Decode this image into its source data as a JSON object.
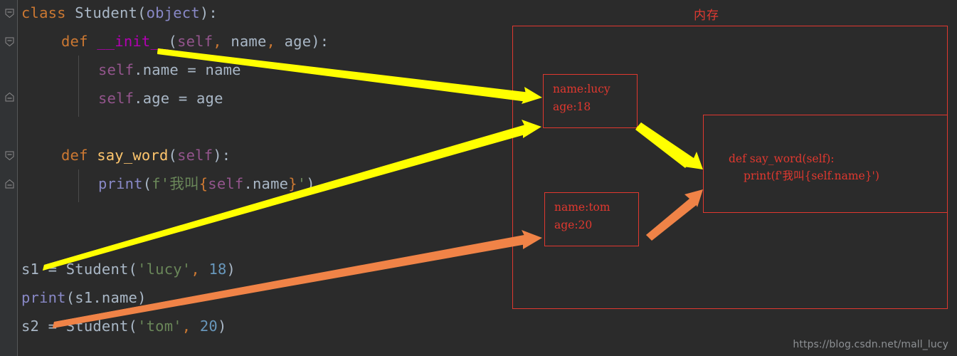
{
  "editor": {
    "background_color": "#2b2b2b",
    "gutter_color": "#313335",
    "fold_markers": [
      "fold-minus-marker",
      "fold-minus-marker",
      "fold-minus-marker",
      "fold-minus-marker",
      "fold-minus-marker"
    ],
    "code_lines": [
      {
        "id": "line-class",
        "text": "class Student(object):"
      },
      {
        "id": "line-init-def",
        "text": "    def __init__(self, name, age):"
      },
      {
        "id": "line-self-name",
        "text": "        self.name = name"
      },
      {
        "id": "line-self-age",
        "text": "        self.age = age"
      },
      {
        "id": "line-blank-1",
        "text": ""
      },
      {
        "id": "line-saywordd",
        "text": "    def say_word(self):"
      },
      {
        "id": "line-print-f",
        "text": "        print(f'我叫{self.name}')"
      },
      {
        "id": "line-blank-2",
        "text": ""
      },
      {
        "id": "line-blank-3",
        "text": ""
      },
      {
        "id": "line-s1",
        "text": "s1 = Student('lucy', 18)"
      },
      {
        "id": "line-print-s1",
        "text": "print(s1.name)"
      },
      {
        "id": "line-s2",
        "text": "s2 = Student('tom', 20)"
      }
    ],
    "tokens": {
      "kw_class": "class",
      "name_student": "Student",
      "builtin_object": "object",
      "kw_def": "def",
      "magic_init": "__init__",
      "self": "self",
      "param_name": "name",
      "param_age": "age",
      "attr_name": ".name",
      "attr_age": ".age",
      "func_say_word": "say_word",
      "func_print": "print",
      "fstring_prefix": "f'我叫",
      "fstring_suffix": "'",
      "var_s1": "s1",
      "var_s2": "s2",
      "str_lucy": "'lucy'",
      "str_tom": "'tom'",
      "num_18": "18",
      "num_20": "20"
    },
    "colors": {
      "keyword": "#cc7832",
      "identifier": "#a9b7c6",
      "builtin": "#8888c6",
      "magic_method": "#b200b2",
      "self": "#94558d",
      "function_name": "#ffc66d",
      "string": "#6a8759",
      "number": "#6897bb"
    }
  },
  "diagram": {
    "title": "内存",
    "title_color": "#e0382f",
    "box_border_color": "#e0382f",
    "objects": [
      {
        "id": "object-lucy",
        "line1": "name:lucy",
        "line2": "age:18"
      },
      {
        "id": "object-tom",
        "line1": "name:tom",
        "line2": "age:20"
      }
    ],
    "method_box": {
      "line1": "def say_word(self):",
      "line2": "print(f'我叫{self.name}')"
    },
    "arrows": [
      {
        "id": "arrow-init-to-lucy",
        "color": "#ffff00",
        "from": "__init__ params",
        "to": "object-lucy"
      },
      {
        "id": "arrow-s1-to-lucy",
        "color": "#ffff00",
        "from": "s1 assignment",
        "to": "object-lucy"
      },
      {
        "id": "arrow-lucy-to-method",
        "color": "#ffff00",
        "from": "object-lucy",
        "to": "method-box"
      },
      {
        "id": "arrow-s2-to-tom",
        "color": "#f08347",
        "from": "s2 assignment",
        "to": "object-tom"
      },
      {
        "id": "arrow-tom-to-method",
        "color": "#f08347",
        "from": "object-tom",
        "to": "method-box"
      }
    ],
    "arrow_colors": {
      "yellow": "#ffff00",
      "orange": "#f08347"
    }
  },
  "watermark": {
    "text": "https://blog.csdn.net/mall_lucy"
  }
}
